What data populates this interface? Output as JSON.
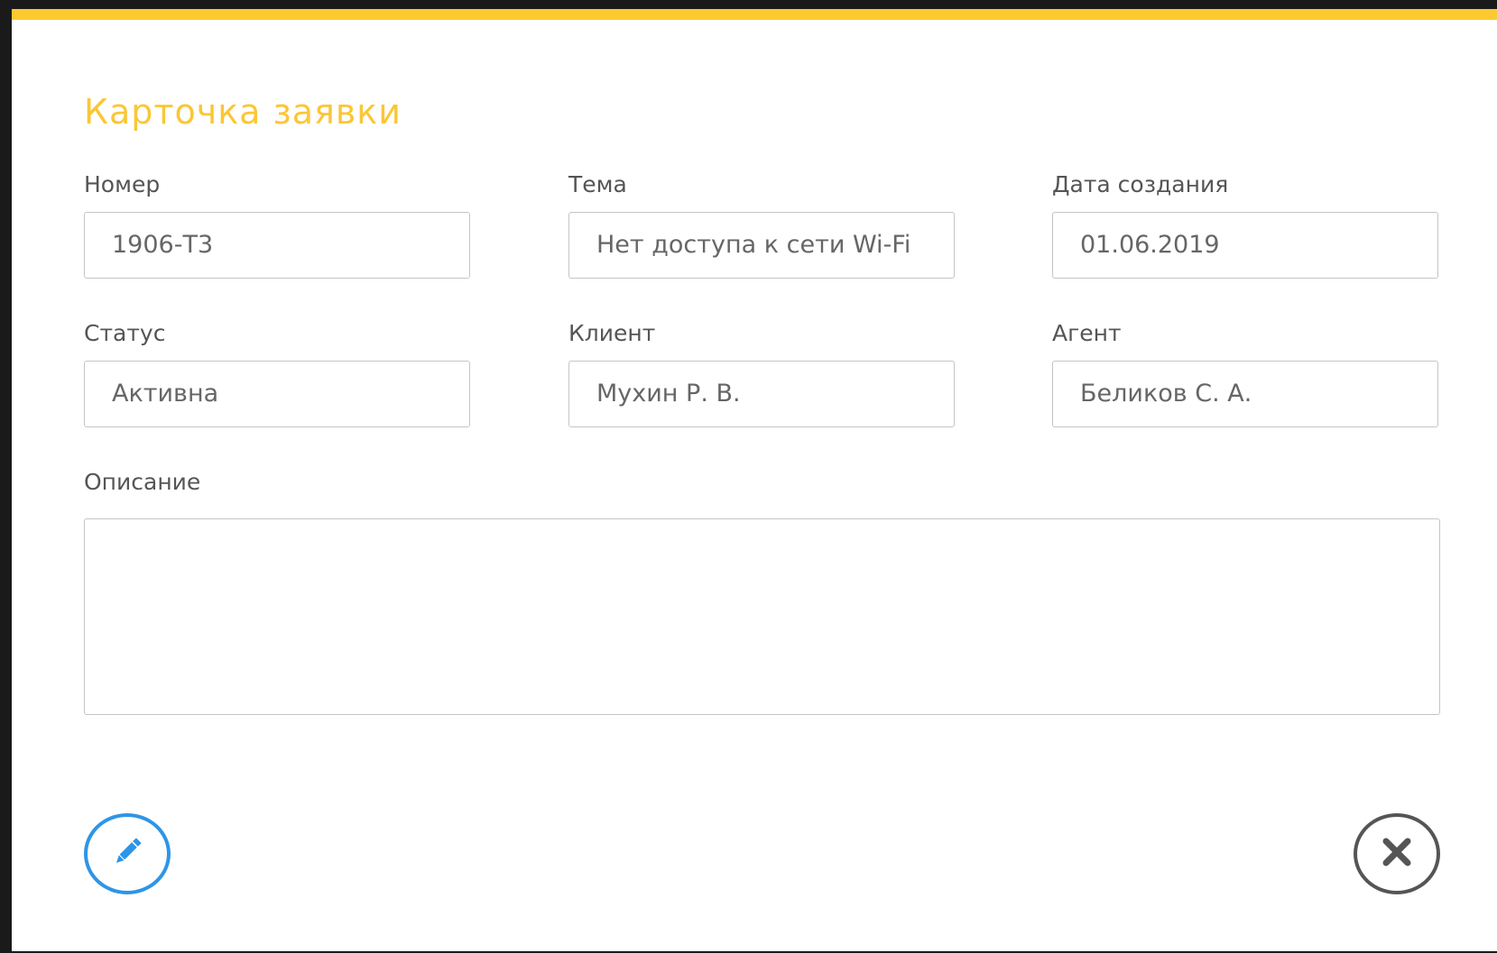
{
  "card": {
    "title": "Карточка заявки",
    "accent_color": "#fcc931",
    "fields": {
      "number": {
        "label": "Номер",
        "value": "1906-Т3"
      },
      "subject": {
        "label": "Тема",
        "value": "Нет доступа к сети Wi-Fi"
      },
      "created_date": {
        "label": "Дата создания",
        "value": "01.06.2019"
      },
      "status": {
        "label": "Статус",
        "value": "Активна"
      },
      "client": {
        "label": "Клиент",
        "value": "Мухин Р. В."
      },
      "agent": {
        "label": "Агент",
        "value": "Беликов С. А."
      },
      "description": {
        "label": "Описание",
        "value": ""
      }
    },
    "actions": {
      "edit_icon": "pencil-icon",
      "edit_color": "#2e95e6",
      "close_icon": "close-icon",
      "close_color": "#555555"
    }
  }
}
